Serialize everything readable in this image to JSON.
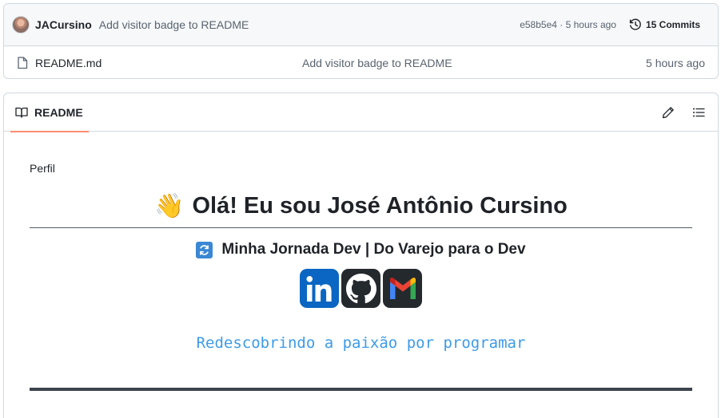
{
  "commit": {
    "author": "JACursino",
    "message": "Add visitor badge to README",
    "sha_time": "e58b5e4 · 5 hours ago",
    "commits_label": "15 Commits"
  },
  "files": [
    {
      "name": "README.md",
      "message": "Add visitor badge to README",
      "time": "5 hours ago"
    }
  ],
  "readme": {
    "tab_label": "README",
    "perfil": "Perfil",
    "hello_emoji": "👋",
    "hello": "Olá! Eu sou José Antônio Cursino",
    "subtitle": "Minha Jornada Dev | Do Varejo para o Dev",
    "social": [
      "linkedin-icon",
      "github-icon",
      "gmail-icon"
    ],
    "tagline": "Redescobrindo a paixão por programar"
  },
  "colors": {
    "tab_underline": "#fd8c73",
    "linkedin": "#0a66c2",
    "tagline": "#3d9be9"
  }
}
